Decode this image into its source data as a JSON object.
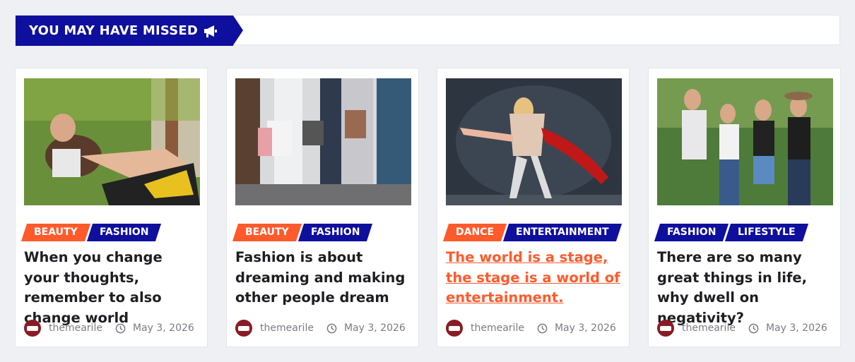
{
  "section": {
    "title": "YOU MAY HAVE MISSED",
    "icon": "megaphone-icon"
  },
  "colors": {
    "brand_blue": "#0f0f9e",
    "accent_orange": "#ff5a2c"
  },
  "posts": [
    {
      "categories": [
        "BEAUTY",
        "FASHION"
      ],
      "title": "When you change your thoughts, remember to also change world",
      "author": "themearile",
      "date": "May 3, 2026",
      "image": "woman-on-motorcycle"
    },
    {
      "categories": [
        "BEAUTY",
        "FASHION"
      ],
      "title": "Fashion is about dreaming and making other people dream",
      "author": "themearile",
      "date": "May 3, 2026",
      "image": "shopping-bags"
    },
    {
      "categories": [
        "DANCE",
        "ENTERTAINMENT"
      ],
      "title": "The world is a stage, the stage is a world of entertainment.",
      "author": "themearile",
      "date": "May 3, 2026",
      "image": "dancers"
    },
    {
      "categories": [
        "FASHION",
        "LIFESTYLE"
      ],
      "title": "There are so many great things in life, why dwell on negativity?",
      "author": "themearile",
      "date": "May 3, 2026",
      "image": "friends-laughing"
    }
  ]
}
